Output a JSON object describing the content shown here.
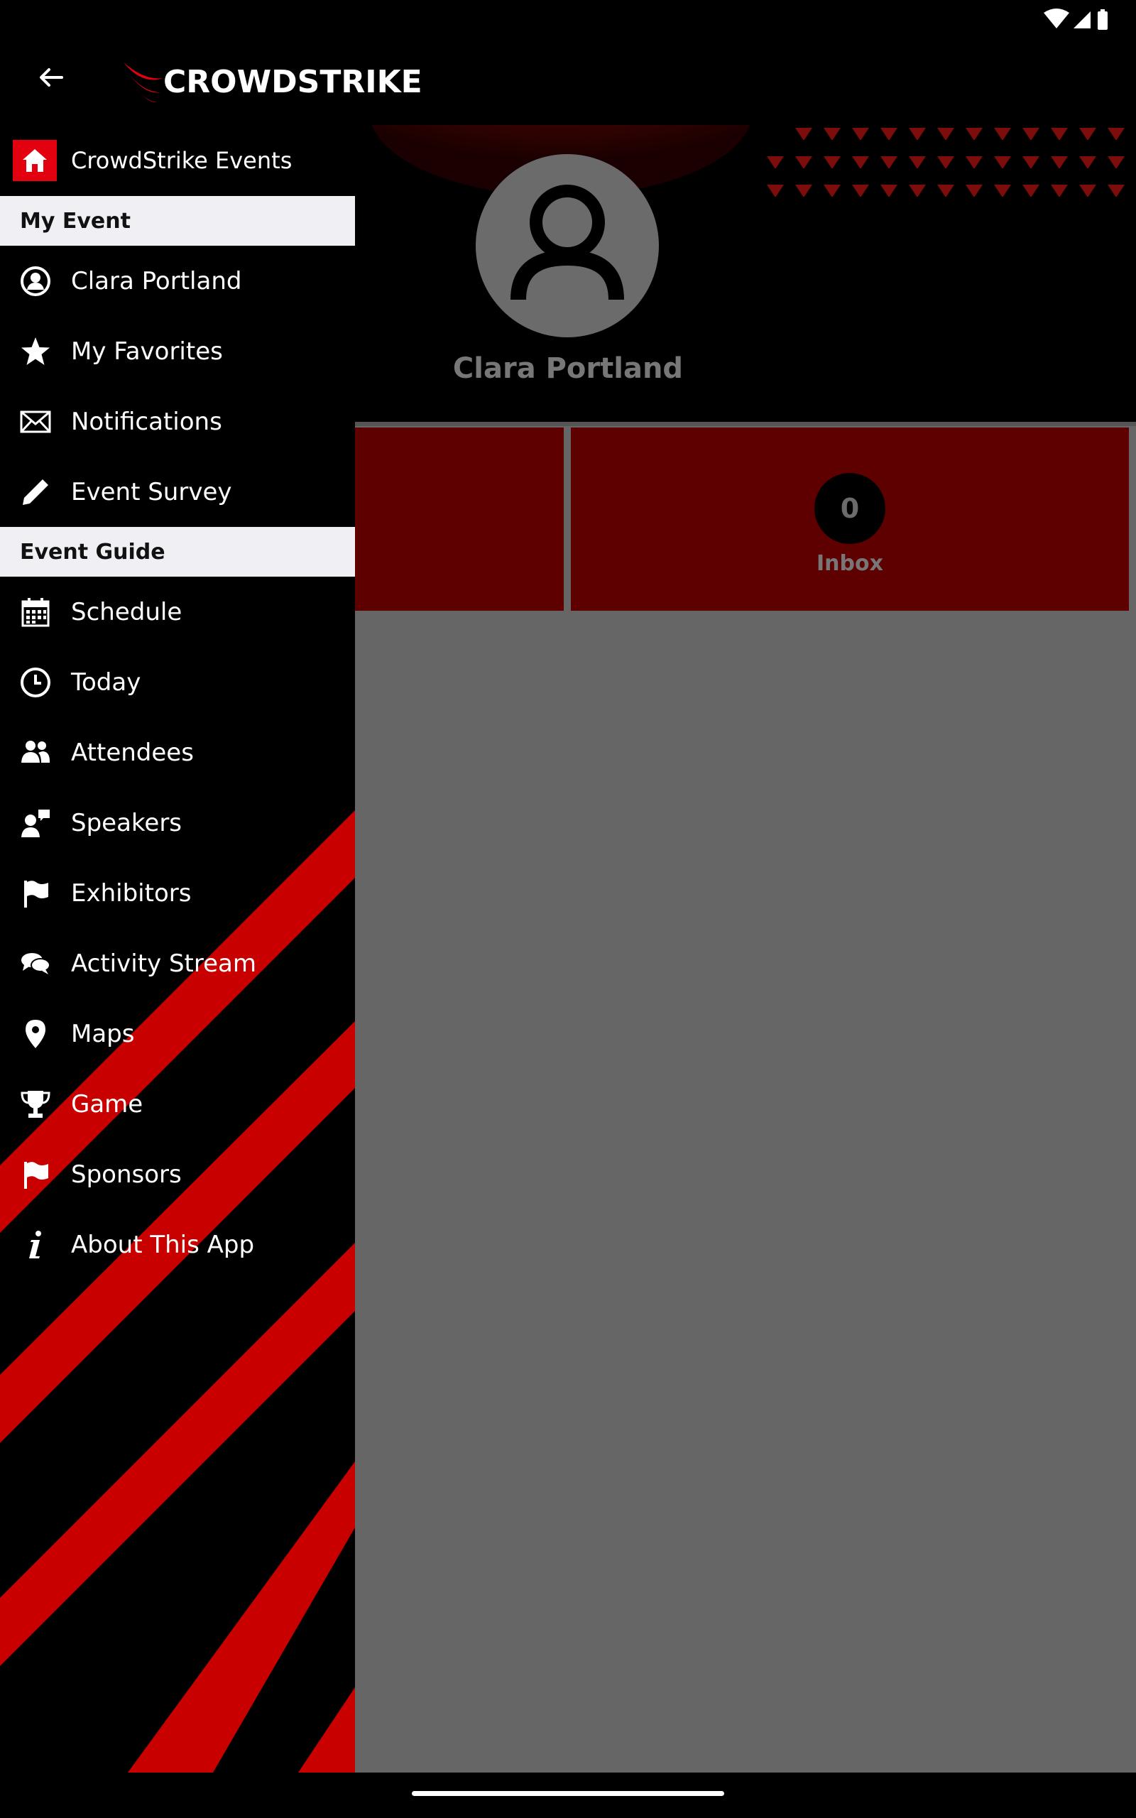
{
  "app": {
    "brand": "CROWDSTRIKE",
    "accent_color": "#e3000f"
  },
  "drawer": {
    "home_label": "CrowdStrike Events",
    "sections": [
      {
        "title": "My Event",
        "items": [
          {
            "label": "Clara Portland",
            "icon": "user-circle-icon"
          },
          {
            "label": "My Favorites",
            "icon": "star-icon"
          },
          {
            "label": "Notifications",
            "icon": "envelope-icon"
          },
          {
            "label": "Event Survey",
            "icon": "pencil-icon"
          }
        ]
      },
      {
        "title": "Event Guide",
        "items": [
          {
            "label": "Schedule",
            "icon": "calendar-icon"
          },
          {
            "label": "Today",
            "icon": "clock-icon"
          },
          {
            "label": "Attendees",
            "icon": "people-icon"
          },
          {
            "label": "Speakers",
            "icon": "speaker-icon"
          },
          {
            "label": "Exhibitors",
            "icon": "flag-icon"
          },
          {
            "label": "Activity Stream",
            "icon": "chat-icon"
          },
          {
            "label": "Maps",
            "icon": "map-pin-icon"
          },
          {
            "label": "Game",
            "icon": "trophy-icon"
          },
          {
            "label": "Sponsors",
            "icon": "flag-icon"
          },
          {
            "label": "About This App",
            "icon": "info-icon"
          }
        ]
      }
    ]
  },
  "profile": {
    "name": "Clara Portland",
    "inbox_count": "0",
    "inbox_label": "Inbox"
  }
}
